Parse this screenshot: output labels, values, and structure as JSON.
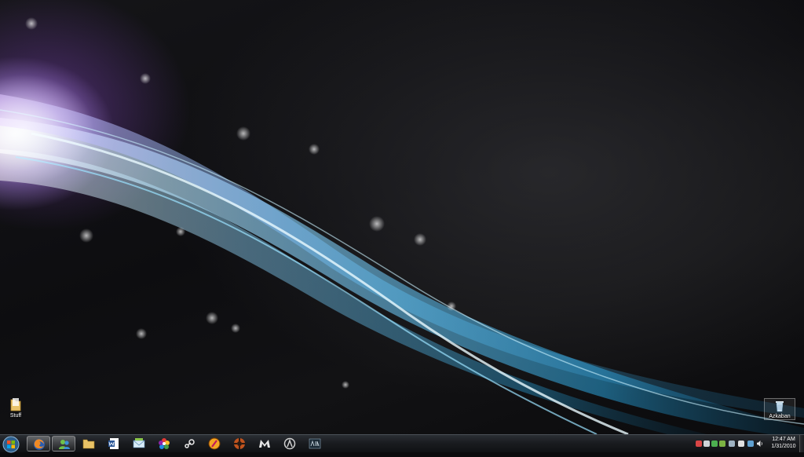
{
  "desktop": {
    "icons": [
      {
        "label": "Stuff",
        "icon": "folder-icon"
      },
      {
        "label": "Azkaban",
        "icon": "recycle-bin-icon"
      }
    ]
  },
  "taskbar": {
    "start": {
      "icon": "windows-logo-icon"
    },
    "pinned": [
      {
        "name": "Firefox",
        "icon": "firefox-icon",
        "active": true
      },
      {
        "name": "Windows Live Messenger",
        "icon": "messenger-icon",
        "active": true
      },
      {
        "name": "Windows Explorer",
        "icon": "explorer-folder-icon",
        "active": false
      },
      {
        "name": "Word",
        "icon": "word-icon",
        "active": false
      },
      {
        "name": "Mail",
        "icon": "mail-icon",
        "active": false
      },
      {
        "name": "Picasa",
        "icon": "picasa-icon",
        "active": false
      },
      {
        "name": "Steam",
        "icon": "steam-icon",
        "active": false
      },
      {
        "name": "Supreme Commander",
        "icon": "supcom-icon",
        "active": false
      },
      {
        "name": "Team Fortress 2",
        "icon": "tf2-icon",
        "active": false
      },
      {
        "name": "Mass Effect",
        "icon": "m-logo-icon",
        "active": false
      },
      {
        "name": "Half-Life 2",
        "icon": "halflife-icon",
        "active": false
      },
      {
        "name": "Aion",
        "icon": "aion-icon",
        "active": false
      }
    ],
    "tray": {
      "icons": [
        "av-icon",
        "steam-tray-icon",
        "network-tray-icon",
        "app-tray-icon",
        "update-tray-icon",
        "flag-icon",
        "monitor-tray-icon",
        "volume-icon"
      ],
      "clock": {
        "time": "12:47 AM",
        "date": "1/31/2010"
      }
    }
  },
  "colors": {
    "taskbar": "#1a1c20",
    "accent": "#4fc3ff"
  }
}
